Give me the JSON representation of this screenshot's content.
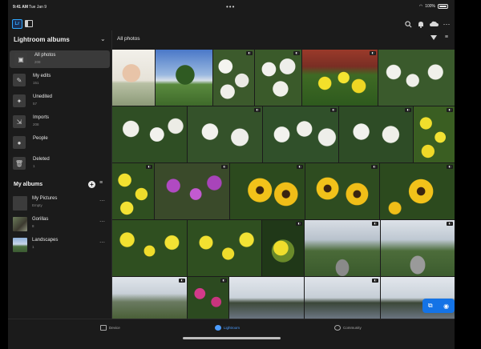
{
  "status_bar": {
    "time": "9:41 AM",
    "date": "Tue Jan 9",
    "battery": "100%"
  },
  "app": {
    "logo_text": "Lr"
  },
  "sidebar": {
    "title": "Lightroom albums",
    "items": [
      {
        "label": "All photos",
        "count": "208",
        "icon": "photos-icon"
      },
      {
        "label": "My edits",
        "count": "151",
        "icon": "pencil-icon"
      },
      {
        "label": "Unedited",
        "count": "57",
        "icon": "wand-icon"
      },
      {
        "label": "Imports",
        "count": "208",
        "icon": "import-icon"
      },
      {
        "label": "People",
        "count": "",
        "icon": "person-icon"
      },
      {
        "label": "Deleted",
        "count": "1",
        "icon": "trash-icon"
      }
    ],
    "albums_header": "My albums",
    "albums": [
      {
        "label": "My Pictures",
        "count": "Empty"
      },
      {
        "label": "Gorillas",
        "count": "8"
      },
      {
        "label": "Landscapes",
        "count": "1"
      }
    ]
  },
  "grid": {
    "title": "All photos"
  },
  "tabs": [
    {
      "label": "Device",
      "active": false
    },
    {
      "label": "Lightroom",
      "active": true
    },
    {
      "label": "Community",
      "active": false
    }
  ],
  "colors": {
    "accent": "#1473e6",
    "background": "#1b1b1b",
    "active_item": "#3a3a3a"
  }
}
